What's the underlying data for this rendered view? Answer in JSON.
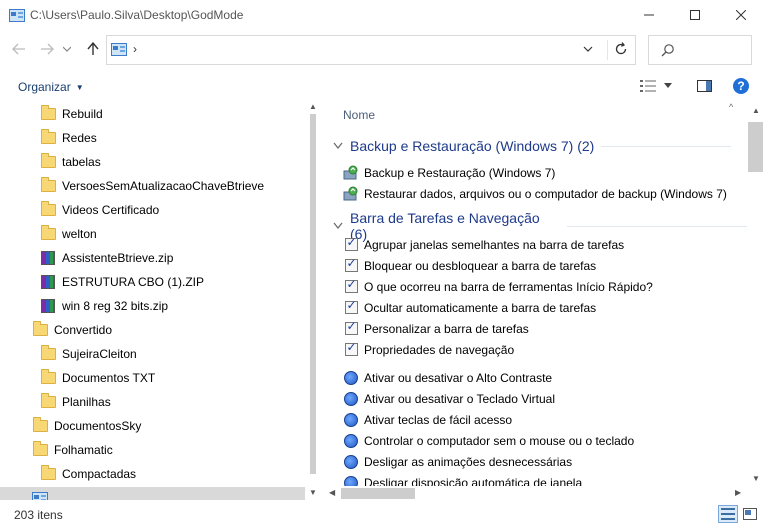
{
  "window": {
    "title": "C:\\Users\\Paulo.Silva\\Desktop\\GodMode",
    "controls": {
      "minimize": "—",
      "maximize": "☐",
      "close": "✕"
    }
  },
  "navigation": {
    "back": "←",
    "forward": "→",
    "recent": "⌄",
    "up": "↑",
    "address_chevron": "›",
    "search_placeholder": ""
  },
  "commandbar": {
    "organize_label": "Organizar",
    "organize_caret": "▼"
  },
  "nav_tree": [
    {
      "label": "Rebuild",
      "icon": "folder-icon"
    },
    {
      "label": "Redes",
      "icon": "folder-icon"
    },
    {
      "label": "tabelas",
      "icon": "folder-icon"
    },
    {
      "label": "VersoesSemAtualizacaoChaveBtrieve",
      "icon": "folder-icon"
    },
    {
      "label": "Videos Certificado",
      "icon": "folder-icon"
    },
    {
      "label": "welton",
      "icon": "folder-icon"
    },
    {
      "label": "AssistenteBtrieve.zip",
      "icon": "zip-icon"
    },
    {
      "label": "ESTRUTURA CBO (1).ZIP",
      "icon": "zip-icon"
    },
    {
      "label": "win 8 reg 32 bits.zip",
      "icon": "zip-icon"
    },
    {
      "label": "Convertido",
      "icon": "folder-icon"
    },
    {
      "label": "SujeiraCleiton",
      "icon": "folder-icon"
    },
    {
      "label": "Documentos TXT",
      "icon": "folder-icon"
    },
    {
      "label": "Planilhas",
      "icon": "folder-icon"
    },
    {
      "label": "DocumentosSky",
      "icon": "folder-icon"
    },
    {
      "label": "Folhamatic",
      "icon": "folder-icon"
    },
    {
      "label": "Compactadas",
      "icon": "folder-icon"
    },
    {
      "label": "",
      "icon": "control-panel-icon",
      "selected": true
    }
  ],
  "content": {
    "column_header": "Nome",
    "groups": [
      {
        "title": "Backup e Restauração (Windows 7) (2)",
        "items": [
          {
            "label": "Backup e Restauração (Windows 7)",
            "icon": "backup-icon"
          },
          {
            "label": "Restaurar dados, arquivos ou o computador de backup (Windows 7)",
            "icon": "backup-icon"
          }
        ]
      },
      {
        "title": "Barra de Tarefas e Navegação (6)",
        "items": [
          {
            "label": "Agrupar janelas semelhantes na barra de tarefas",
            "icon": "taskbar-icon"
          },
          {
            "label": "Bloquear ou desbloquear a barra de tarefas",
            "icon": "taskbar-icon"
          },
          {
            "label": "O que ocorreu na barra de ferramentas Início Rápido?",
            "icon": "taskbar-icon"
          },
          {
            "label": "Ocultar automaticamente a barra de tarefas",
            "icon": "taskbar-icon"
          },
          {
            "label": "Personalizar a barra de tarefas",
            "icon": "taskbar-icon"
          },
          {
            "label": "Propriedades de navegação",
            "icon": "taskbar-icon"
          }
        ]
      }
    ],
    "ease_items": [
      {
        "label": "Ativar ou desativar o Alto Contraste",
        "icon": "ease-of-access-icon"
      },
      {
        "label": "Ativar ou desativar o Teclado Virtual",
        "icon": "ease-of-access-icon"
      },
      {
        "label": "Ativar teclas de fácil acesso",
        "icon": "ease-of-access-icon"
      },
      {
        "label": "Controlar o computador sem o mouse ou o teclado",
        "icon": "ease-of-access-icon"
      },
      {
        "label": "Desligar as animações desnecessárias",
        "icon": "ease-of-access-icon"
      },
      {
        "label": "Desligar disposição automática de janela",
        "icon": "ease-of-access-icon"
      }
    ]
  },
  "status": {
    "item_count": "203 itens"
  },
  "colors": {
    "group_title": "#1e3a8a",
    "accent": "#1f6fd6",
    "folder": "#f8d775"
  }
}
